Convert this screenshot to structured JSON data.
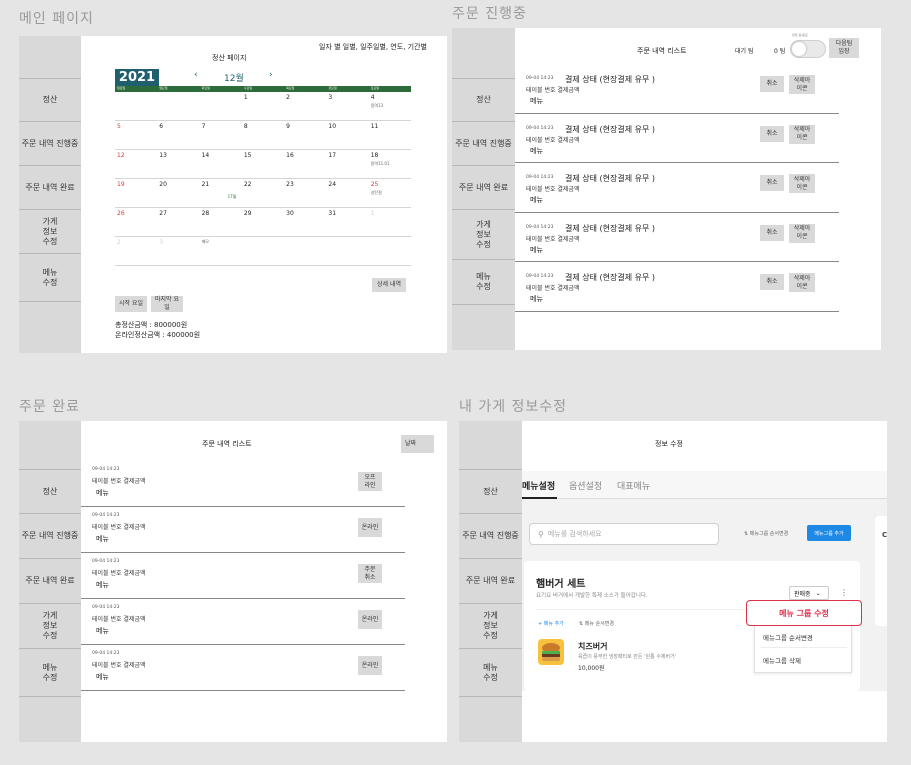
{
  "sections": {
    "main": "메인 페이지",
    "in_progress": "주문 진행중",
    "done": "주문 완료",
    "store_edit": "내 가게 정보수정"
  },
  "sidebar": {
    "settlement": "정산",
    "in_progress": "주문 내역 진행중",
    "completed": "주문 내역 완료",
    "store_info": "가게\n정보\n수정",
    "menu_edit": "메뉴\n수정"
  },
  "main_page": {
    "header_right": "일자 별 일별, 일주일별, 연도, 기간별",
    "page_title": "정산 페이지",
    "year": "2021",
    "prev": "‹",
    "month": "12월",
    "next": "›",
    "weekdays": [
      "일요일",
      "월요일",
      "화요일",
      "수요일",
      "목요일",
      "금요일",
      "토요일"
    ],
    "weeks": [
      [
        {
          "d": "",
          "c": ""
        },
        {
          "d": "",
          "c": ""
        },
        {
          "d": "",
          "c": ""
        },
        {
          "d": "1",
          "c": ""
        },
        {
          "d": "2",
          "c": ""
        },
        {
          "d": "3",
          "c": ""
        },
        {
          "d": "4",
          "c": "",
          "n": "용역13"
        }
      ],
      [
        {
          "d": "5",
          "c": "red"
        },
        {
          "d": "6",
          "c": ""
        },
        {
          "d": "7",
          "c": ""
        },
        {
          "d": "8",
          "c": ""
        },
        {
          "d": "9",
          "c": ""
        },
        {
          "d": "10",
          "c": ""
        },
        {
          "d": "11",
          "c": ""
        }
      ],
      [
        {
          "d": "12",
          "c": "red"
        },
        {
          "d": "13",
          "c": ""
        },
        {
          "d": "14",
          "c": ""
        },
        {
          "d": "15",
          "c": ""
        },
        {
          "d": "16",
          "c": ""
        },
        {
          "d": "17",
          "c": ""
        },
        {
          "d": "18",
          "c": "",
          "n": "용역11.01"
        }
      ],
      [
        {
          "d": "19",
          "c": "red"
        },
        {
          "d": "20",
          "c": ""
        },
        {
          "d": "21",
          "c": "",
          "n": "17월"
        },
        {
          "d": "22",
          "c": ""
        },
        {
          "d": "23",
          "c": ""
        },
        {
          "d": "24",
          "c": ""
        },
        {
          "d": "25",
          "c": "red",
          "n": "성탄절"
        }
      ],
      [
        {
          "d": "26",
          "c": "red"
        },
        {
          "d": "27",
          "c": ""
        },
        {
          "d": "28",
          "c": ""
        },
        {
          "d": "29",
          "c": ""
        },
        {
          "d": "30",
          "c": ""
        },
        {
          "d": "31",
          "c": ""
        },
        {
          "d": "1",
          "c": "faded"
        }
      ],
      [
        {
          "d": "2",
          "c": "faded"
        },
        {
          "d": "3",
          "c": "faded"
        },
        {
          "d": "",
          "c": "",
          "n": "메모"
        },
        {
          "d": "",
          "c": ""
        },
        {
          "d": "",
          "c": ""
        },
        {
          "d": "",
          "c": ""
        },
        {
          "d": "",
          "c": ""
        }
      ]
    ],
    "detail_btn": "상세 내역",
    "start_btn": "시작 요일",
    "end_btn": "마지막 요\n일",
    "total": "총정산금액 : 800000원",
    "online_total": "온라인정산금액 : 400000원"
  },
  "progress_page": {
    "title": "주문 내역 리스트",
    "wait_label": "대기 팀",
    "wait_count": "0 팀",
    "toggle_caption": "영업 중/종료",
    "next_team": "다음팀\n입장",
    "orders": [
      {
        "date": "09-04 14:23",
        "status": "결제 상태 (현장결제 유무 )",
        "sub": "테이블 번호   결제금액",
        "menu": "메뉴",
        "cancel": "취소",
        "delete": "삭제아\n이콘"
      },
      {
        "date": "09-04 14:23",
        "status": "결제 상태 (현장결제 유무 )",
        "sub": "테이블 번호   결제금액",
        "menu": "메뉴",
        "cancel": "취소",
        "delete": "삭제아\n이콘"
      },
      {
        "date": "09-04 14:23",
        "status": "결제 상태 (현장결제 유무 )",
        "sub": "테이블 번호   결제금액",
        "menu": "메뉴",
        "cancel": "취소",
        "delete": "삭제아\n이콘"
      },
      {
        "date": "09-04 14:23",
        "status": "결제 상태 (현장결제 유무 )",
        "sub": "테이블 번호   결제금액",
        "menu": "메뉴",
        "cancel": "취소",
        "delete": "삭제아\n이콘"
      },
      {
        "date": "09-04 14:23",
        "status": "결제 상태 (현장결제 유무 )",
        "sub": "테이블 번호   결제금액",
        "menu": "메뉴",
        "cancel": "취소",
        "delete": "삭제아\n이콘"
      }
    ]
  },
  "done_page": {
    "title": "주문 내역 리스트",
    "date_btn": "날짜",
    "orders": [
      {
        "date": "09-04 14:23",
        "sub": "테이블 번호   결제금액",
        "menu": "메뉴",
        "tag": "오프\n라인"
      },
      {
        "date": "09-04 14:23",
        "sub": "테이블 번호   결제금액",
        "menu": "메뉴",
        "tag": "온라인"
      },
      {
        "date": "09-04 14:23",
        "sub": "테이블 번호   결제금액",
        "menu": "메뉴",
        "tag": "주문\n취소"
      },
      {
        "date": "09-04 14:23",
        "sub": "테이블 번호   결제금액",
        "menu": "메뉴",
        "tag": "온라인"
      },
      {
        "date": "09-04 14:23",
        "sub": "테이블 번호   결제금액",
        "menu": "메뉴",
        "tag": "온라인"
      }
    ]
  },
  "store_page": {
    "title": "정보 수정",
    "tabs": [
      "메뉴설정",
      "옵션설정",
      "대표메뉴"
    ],
    "search_placeholder": "메뉴를 검색하세요",
    "reorder_label": "⇅ 메뉴그룹 순서변경",
    "add_group_btn": "메뉴그룹 추가",
    "group_name": "햄버거 세트",
    "group_desc": "요기요 버거에서 개발한 특제 소스가 들어갑니다.",
    "sale_state": "판매중",
    "add_menu": "+ 메뉴 추가",
    "menu_reorder": "⇅ 메뉴 순서변경",
    "item_name": "치즈버거",
    "item_desc": "육즙이 풍부한 냉장패티로 만든 '원톱 수제버거'",
    "item_price": "10,000원",
    "popup_highlight": "메뉴 그룹 수정",
    "popup_items": [
      "메뉴그룹 순서변경",
      "메뉴그룹 삭제"
    ],
    "right_card_letter": "C"
  },
  "colors": {
    "calendar_header": "#1f5f6e",
    "weekday_bar": "#2d6b3a",
    "accent_red": "#e0314b",
    "accent_blue": "#1e88e5"
  }
}
